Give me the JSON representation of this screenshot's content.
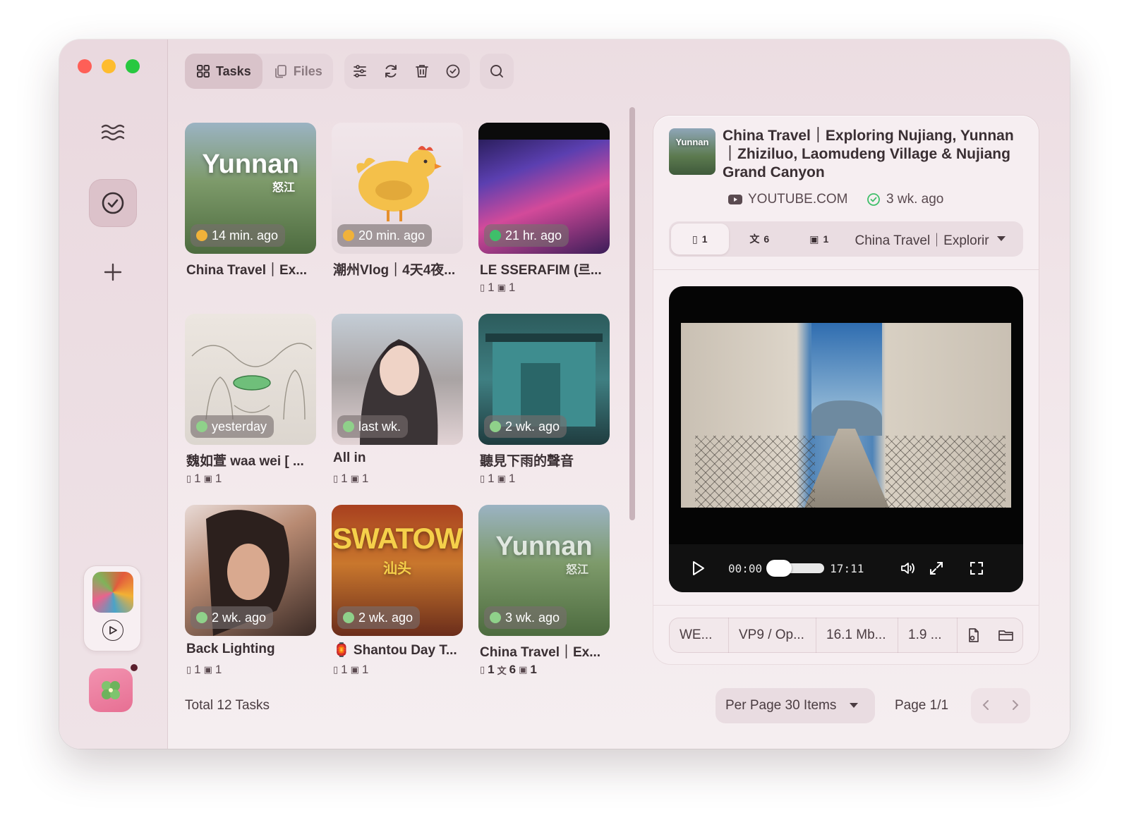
{
  "toolbar": {
    "tasks_label": "Tasks",
    "files_label": "Files"
  },
  "cards": [
    {
      "thumb_text": "Yunnan",
      "thumb_sub": "怒江",
      "time": "14 min. ago",
      "title": "China Travel｜Ex...",
      "meta": [],
      "badge_color": "#f0b23a",
      "bg": "linear-gradient(180deg,#9bb3c3 0%,#7d9a6a 45%,#4d6b3f 100%)"
    },
    {
      "thumb_text": "",
      "thumb_sub": "",
      "time": "20 min. ago",
      "title": "潮州Vlog｜4天4夜...",
      "meta": [],
      "badge_color": "#f0b23a",
      "bg": "linear-gradient(180deg,#f1e6ea 0%,#e6d9de 100%)"
    },
    {
      "thumb_text": "",
      "thumb_sub": "",
      "time": "21 hr. ago",
      "title": "LE SSERAFIM (르...",
      "meta": [
        "1",
        "1"
      ],
      "badge_color": "#3fbf6a",
      "bg": "linear-gradient(160deg,#1a1340 0%,#5b3fb0 35%,#d34a9a 60%,#3b1d58 100%)"
    },
    {
      "thumb_text": "",
      "thumb_sub": "",
      "time": "yesterday",
      "title": "魏如萱 waa wei [ ...",
      "meta": [
        "1",
        "1"
      ],
      "badge_color": "#8fd18a",
      "bg": "linear-gradient(180deg,#ece6e0 0%,#dcd6cf 100%)"
    },
    {
      "thumb_text": "",
      "thumb_sub": "",
      "time": "last wk.",
      "title": "All in",
      "meta": [
        "1",
        "1"
      ],
      "badge_color": "#8fd18a",
      "bg": "linear-gradient(180deg,#c4cdd6 0%,#a9a3a3 50%,#e2d3d5 100%)"
    },
    {
      "thumb_text": "",
      "thumb_sub": "",
      "time": "2 wk. ago",
      "title": "聽見下雨的聲音",
      "meta": [
        "1",
        "1"
      ],
      "badge_color": "#8fd18a",
      "bg": "linear-gradient(180deg,#2c5b5c 0%,#3f7f82 50%,#1f3c3f 100%)"
    },
    {
      "thumb_text": "",
      "thumb_sub": "",
      "time": "2 wk. ago",
      "title": "Back Lighting",
      "meta": [
        "1",
        "1"
      ],
      "badge_color": "#8fd18a",
      "bg": "linear-gradient(150deg,#e8dad6 0%,#b88a72 40%,#3a2a25 100%)"
    },
    {
      "thumb_text": "SWATOW",
      "thumb_sub": "汕头",
      "time": "2 wk. ago",
      "title": "🏮 Shantou Day T...",
      "meta": [
        "1",
        "1"
      ],
      "badge_color": "#8fd18a",
      "bg": "linear-gradient(180deg,#a8401f 0%,#c9772d 45%,#6b2d1b 100%)"
    },
    {
      "thumb_text": "Yunnan",
      "thumb_sub": "怒江",
      "time": "3 wk. ago",
      "title": "China Travel｜Ex...",
      "meta": [
        "1",
        "6",
        "1"
      ],
      "badge_color": "#8fd18a",
      "bg": "linear-gradient(180deg,#9bb3c3 0%,#7d9a6a 45%,#4d6b3f 100%)"
    }
  ],
  "footer": {
    "total": "Total 12 Tasks",
    "per_page": "Per Page 30 Items",
    "page": "Page 1/1"
  },
  "detail": {
    "thumb_text": "Yunnan",
    "title": "China Travel｜Exploring Nujiang, Yunnan｜Zhiziluo, Laomudeng Village & Nujiang Grand Canyon",
    "source": "YOUTUBE.COM",
    "ago": "3 wk. ago",
    "tabs": [
      {
        "icon": "▯",
        "count": "1"
      },
      {
        "icon": "文",
        "count": "6"
      },
      {
        "icon": "▣",
        "count": "1"
      }
    ],
    "select_value": "China Travel｜Explorir",
    "player": {
      "current": "00:00",
      "duration": "17:11",
      "progress": 0
    },
    "info": [
      "WE...",
      "VP9 / Op...",
      "16.1 Mb...",
      "1.9 ..."
    ]
  },
  "colors": {
    "accent": "#dcc2ca",
    "success": "#3fbf6a",
    "window_bg": "#efe3e7"
  }
}
